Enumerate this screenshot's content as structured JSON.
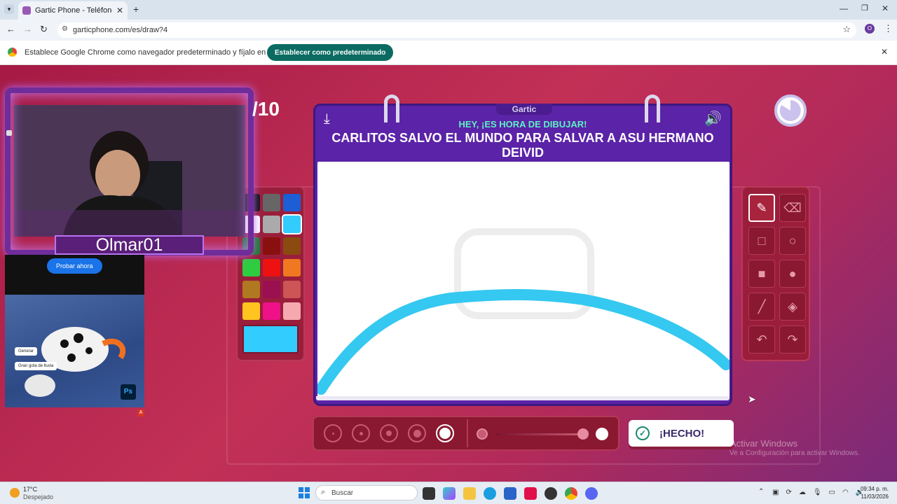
{
  "browser": {
    "tab_title": "Gartic Phone - Teléfono Descon",
    "url": "garticphone.com/es/draw?4",
    "profile_initial": "O",
    "infobar_text": "Establece Google Chrome como navegador predeterminado y fíjalo en la barra de tareas",
    "infobar_button": "Establecer como predeterminado"
  },
  "game": {
    "brand": "Gartic",
    "subtitle": "HEY, ¡ES HORA DE DIBUJAR!",
    "prompt": "CARLITOS SALVO EL MUNDO PARA SALVAR A ASU HERMANO DEIVID",
    "round": "/10",
    "done_label": "¡HECHO!",
    "palette": [
      "#111111",
      "#666666",
      "#1c5fd4",
      "#ffffff",
      "#aaaaaa",
      "#33ccff",
      "#1d7a2e",
      "#8a1010",
      "#8a4a10",
      "#2ecc40",
      "#ee1111",
      "#f07820",
      "#b07820",
      "#9a1050",
      "#cc5555",
      "#ffc420",
      "#ee1188",
      "#f5a8b0"
    ],
    "selected_color": "#33ccff",
    "stroke_color": "#35c8f0",
    "brush_sizes_count": 5,
    "opacity_levels": 3
  },
  "stream": {
    "streamer_name": "Olmar01",
    "ad_button": "Probar ahora",
    "ad_chip1": "Generar",
    "ad_chip2": "Gran gota de lluvia"
  },
  "windows": {
    "activate_title": "Activar Windows",
    "activate_sub": "Ve a Configuración para activar Windows.",
    "weather_temp": "17°C",
    "weather_desc": "Despejado",
    "search_placeholder": "Buscar",
    "time": "09:34 p. m.",
    "date": "11/03/2026"
  }
}
